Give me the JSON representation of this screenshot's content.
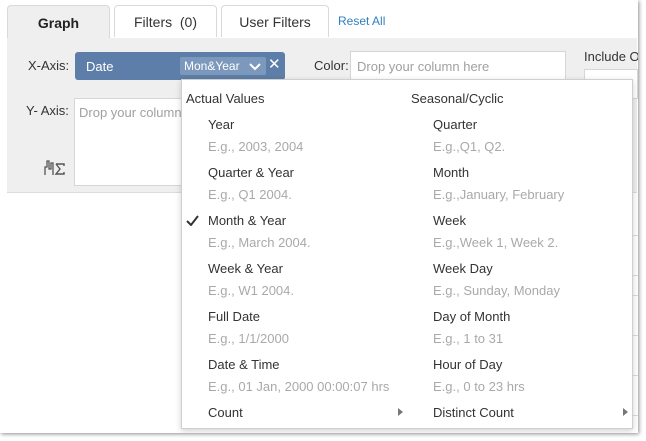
{
  "tabs": [
    {
      "label": "Graph",
      "active": true
    },
    {
      "label": "Filters  (0)",
      "active": false
    },
    {
      "label": "User Filters",
      "active": false
    }
  ],
  "reset_all": "Reset All",
  "xaxis": {
    "label": "X-Axis:",
    "field": "Date",
    "aggregation": "Mon&Year"
  },
  "yaxis": {
    "label": "Y- Axis:",
    "placeholder": "Drop your column here"
  },
  "color": {
    "label": "Color:",
    "placeholder": "Drop your column here"
  },
  "include": {
    "label": "Include Other"
  },
  "dropdown": {
    "left_header": "Actual Values",
    "right_header": "Seasonal/Cyclic",
    "left_options": [
      {
        "name": "Year",
        "example": "E.g., 2003, 2004"
      },
      {
        "name": "Quarter & Year",
        "example": "E.g., Q1 2004."
      },
      {
        "name": "Month & Year",
        "example": "E.g., March 2004.",
        "selected": true
      },
      {
        "name": "Week & Year",
        "example": "E.g., W1 2004."
      },
      {
        "name": "Full Date",
        "example": "E.g., 1/1/2000"
      },
      {
        "name": "Date & Time",
        "example": "E.g., 01 Jan, 2000 00:00:07 hrs"
      }
    ],
    "right_options": [
      {
        "name": "Quarter",
        "example": "E.g.,Q1, Q2."
      },
      {
        "name": "Month",
        "example": "E.g.,January, February"
      },
      {
        "name": "Week",
        "example": "E.g.,Week 1, Week 2."
      },
      {
        "name": "Week Day",
        "example": "E.g., Sunday, Monday"
      },
      {
        "name": "Day of Month",
        "example": "E.g., 1 to 31"
      },
      {
        "name": "Hour of Day",
        "example": "E.g., 0 to 23 hrs"
      }
    ],
    "left_footer": "Count",
    "right_footer": "Distinct Count"
  },
  "colors": {
    "pill": "#5d7ea8",
    "link": "#2f7fc1",
    "panel": "#efefef"
  }
}
